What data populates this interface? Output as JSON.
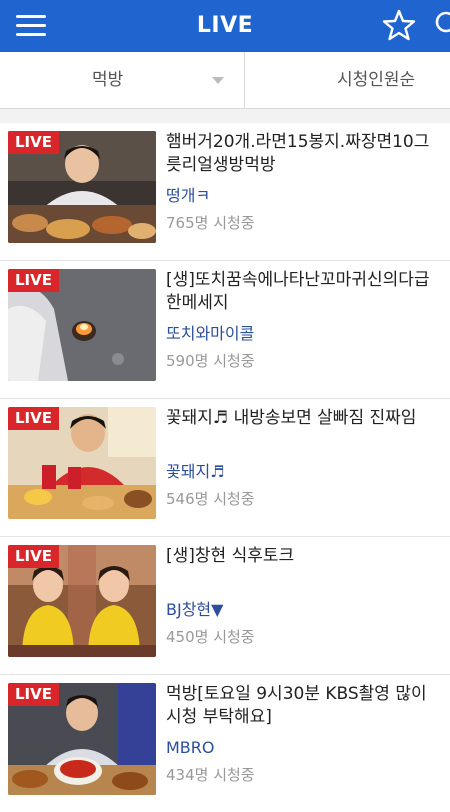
{
  "header": {
    "title": "LIVE",
    "left_icon": "hamburger-menu-icon",
    "right_icons": [
      "star-icon",
      "search-icon"
    ],
    "bg_color": "#1f64cf"
  },
  "filters": {
    "category": "먹방",
    "sort": "시청인원순"
  },
  "badge_label": "LIVE",
  "streams": [
    {
      "title": "햄버거20개.라면15봉지.짜장면10그\n릇리얼생방먹방",
      "bj": "떵개ㅋ",
      "viewers": "765명 시청중"
    },
    {
      "title": "[생]또치꿈속에나타난꼬마귀신의다급\n한메세지",
      "bj": "또치와마이콜",
      "viewers": "590명 시청중"
    },
    {
      "title": "꽃돼지♬ 내방송보면 살빠짐 진짜임",
      "bj": "꽃돼지♬",
      "viewers": "546명 시청중"
    },
    {
      "title": "[생]창현 식후토크",
      "bj": "BJ창현▼",
      "viewers": "450명 시청중"
    },
    {
      "title": "먹방[토요일 9시30분 KBS촬영 많이\n시청 부탁해요]",
      "bj": "MBRO",
      "viewers": "434명 시청중"
    }
  ]
}
